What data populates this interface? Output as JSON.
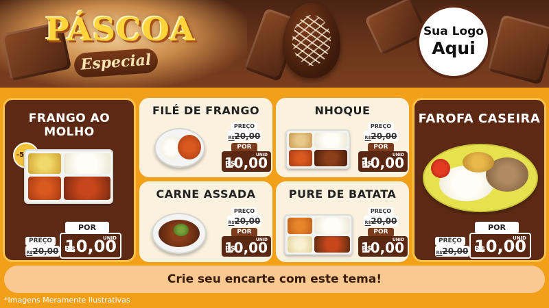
{
  "header": {
    "title": "PÁSCOA",
    "subtitle": "Especial",
    "logo_line1": "Sua Logo",
    "logo_line2": "Aqui"
  },
  "products": [
    {
      "name": "FRANGO AO MOLHO",
      "badge": "-50%",
      "preco_label": "PREÇO",
      "old_currency": "R$",
      "old_price": "20,00",
      "por_label": "POR",
      "currency": "R$",
      "new_price": "10,00",
      "unit": "UNID"
    },
    {
      "name": "FILÉ DE FRANGO",
      "preco_label": "PREÇO",
      "old_currency": "R$",
      "old_price": "20,00",
      "por_label": "POR",
      "currency": "R$",
      "new_price": "10,00",
      "unit": "UNID"
    },
    {
      "name": "NHOQUE",
      "preco_label": "PREÇO",
      "old_currency": "R$",
      "old_price": "20,00",
      "por_label": "POR",
      "currency": "R$",
      "new_price": "10,00",
      "unit": "UNID"
    },
    {
      "name": "FAROFA CASEIRA",
      "preco_label": "PREÇO",
      "old_currency": "R$",
      "old_price": "20,00",
      "por_label": "POR",
      "currency": "R$",
      "new_price": "10,00",
      "unit": "UNID"
    },
    {
      "name": "CARNE ASSADA",
      "preco_label": "PREÇO",
      "old_currency": "R$",
      "old_price": "20,00",
      "por_label": "POR",
      "currency": "R$",
      "new_price": "10,00",
      "unit": "UNID"
    },
    {
      "name": "PURE DE BATATA",
      "preco_label": "PREÇO",
      "old_currency": "R$",
      "old_price": "20,00",
      "por_label": "POR",
      "currency": "R$",
      "new_price": "10,00",
      "unit": "UNID"
    }
  ],
  "banner": "Crie seu encarte com este tema!",
  "footer": "*Imagens Meramente Ilustrativas",
  "colors": {
    "brown_dark": "#5c2a14",
    "orange": "#f2a019",
    "gold": "#ffd43a",
    "cream": "#fbf1df",
    "banner": "#f9c991"
  }
}
